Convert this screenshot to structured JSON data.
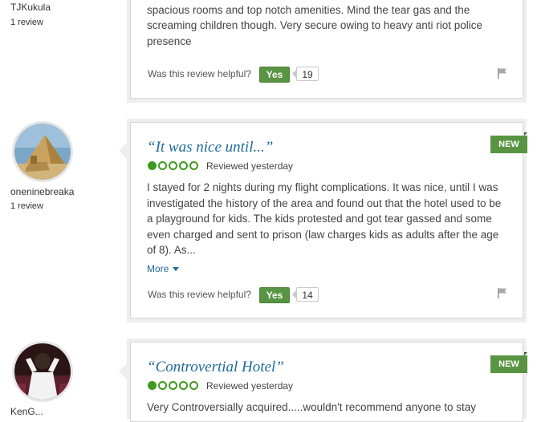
{
  "reviews": [
    {
      "username": "TJKukula",
      "review_count": "1 review",
      "body": "Nice Space. Carved out of the adjacent Langata Primary School offers spacious rooms and top notch amenities. Mind the tear gas and the screaming children though. Very secure owing to heavy anti riot police presence",
      "helpful_prompt": "Was this review helpful?",
      "yes_label": "Yes",
      "helpful_count": "19"
    },
    {
      "username": "oneninebreaka",
      "review_count": "1 review",
      "title": "“It was nice until...”",
      "rating": 1,
      "date": "Reviewed yesterday",
      "badge": "NEW",
      "body": "I stayed for 2 nights during my flight complications. It was nice, until I was investigated the history of the area and found out that the hotel used to be a playground for kids. The kids protested and got tear gassed and some even charged and sent to prison (law charges kids as adults after the age of 8). As...",
      "more_label": "More",
      "helpful_prompt": "Was this review helpful?",
      "yes_label": "Yes",
      "helpful_count": "14"
    },
    {
      "username": "KenG...",
      "title": "“Controvertial Hotel”",
      "rating": 1,
      "date": "Reviewed yesterday",
      "badge": "NEW",
      "body": "Very Controversially acquired.....wouldn't recommend anyone to stay"
    }
  ],
  "icons": {
    "flag": "flag-icon",
    "more_caret": "caret-down-icon"
  },
  "colors": {
    "accent_green": "#589442",
    "title_blue": "#1f6a9a",
    "rating_green": "#3f9a1f"
  }
}
